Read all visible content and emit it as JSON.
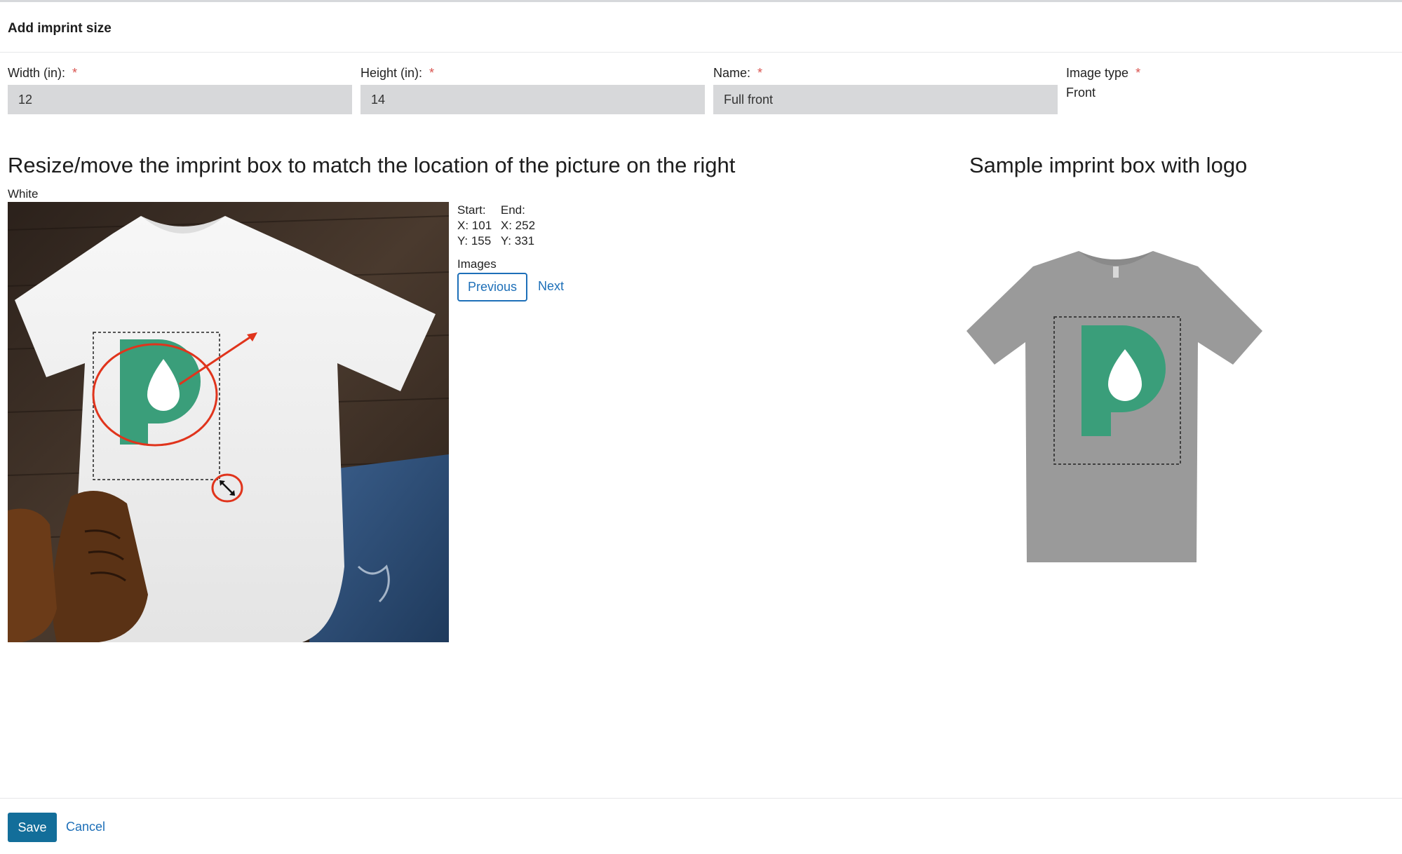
{
  "header": {
    "title": "Add imprint size"
  },
  "fields": {
    "width": {
      "label": "Width (in):",
      "required_mark": "*",
      "value": "12"
    },
    "height": {
      "label": "Height (in):",
      "required_mark": "*",
      "value": "14"
    },
    "name": {
      "label": "Name:",
      "required_mark": "*",
      "value": "Full front"
    },
    "image_type": {
      "label": "Image type",
      "required_mark": "*",
      "value": "Front"
    }
  },
  "editor": {
    "title": "Resize/move the imprint box to match the location of the picture on the right",
    "color_label": "White",
    "coords": {
      "start_label": "Start:",
      "end_label": "End:",
      "start_x": "X: 101",
      "start_y": "Y: 155",
      "end_x": "X: 252",
      "end_y": "Y: 331"
    },
    "images_label": "Images",
    "previous_label": "Previous",
    "next_label": "Next"
  },
  "sample": {
    "title": "Sample imprint box with logo"
  },
  "footer": {
    "save_label": "Save",
    "cancel_label": "Cancel"
  },
  "colors": {
    "accent": "#1d6fb8",
    "save_button": "#136e9a",
    "required": "#d9534f",
    "logo_green": "#3a9e7a",
    "annotation_red": "#e0341c",
    "input_bg": "#d7d8da"
  },
  "icons": {
    "resize_handle": "resize-diagonal-icon",
    "logo": "p-drop-logo"
  }
}
